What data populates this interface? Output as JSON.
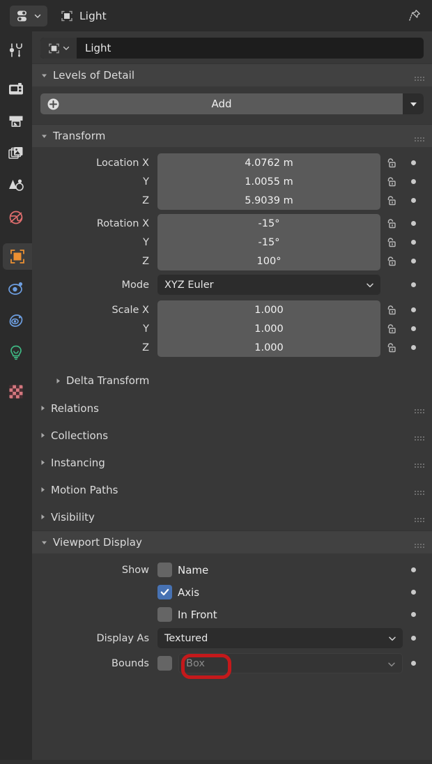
{
  "window": {
    "editor_type_icon": "properties-editor-icon",
    "breadcrumb_icon": "object-icon",
    "breadcrumb_label": "Light",
    "pin_icon": "pin-icon"
  },
  "tabs": [
    {
      "name": "tool",
      "icon": "tool-icon",
      "color": "#d8d8d8",
      "active": false
    },
    {
      "name": "render",
      "icon": "camera-back-icon",
      "color": "#d8d8d8",
      "active": false
    },
    {
      "name": "output",
      "icon": "printer-icon",
      "color": "#d8d8d8",
      "active": false
    },
    {
      "name": "view-layer",
      "icon": "images-icon",
      "color": "#d8d8d8",
      "active": false
    },
    {
      "name": "scene",
      "icon": "cone-sphere-icon",
      "color": "#d8d8d8",
      "active": false
    },
    {
      "name": "world",
      "icon": "world-icon",
      "color": "#e06e6e",
      "active": false
    },
    {
      "name": "object",
      "icon": "object-square-icon",
      "color": "#ec9032",
      "active": true
    },
    {
      "name": "modifiers",
      "icon": "physics-icon",
      "color": "#6d9ee0",
      "active": false
    },
    {
      "name": "constraints",
      "icon": "constraint-icon",
      "color": "#6d9ee0",
      "active": false
    },
    {
      "name": "data",
      "icon": "light-bulb-icon",
      "color": "#3fb984",
      "active": false
    },
    {
      "name": "texture",
      "icon": "checker-icon",
      "color": "#d4777e",
      "active": false
    }
  ],
  "id_block": {
    "icon": "object-icon",
    "dropdown_icon": "chevron-down-icon",
    "name": "Light"
  },
  "panels": {
    "levels_of_detail": {
      "title": "Levels of Detail",
      "expanded": true,
      "triangle": "triangle-down-icon",
      "grip": "grip-icon",
      "add_button": {
        "label": "Add",
        "icon": "plus-circle-icon",
        "menu_icon": "triangle-down-icon"
      }
    },
    "transform": {
      "title": "Transform",
      "expanded": true,
      "triangle": "triangle-down-icon",
      "grip": "grip-icon",
      "location": {
        "label": "Location X",
        "rows": [
          {
            "label": "Location X",
            "value": "4.0762 m",
            "lock": "unlocked-icon",
            "animate": "animate-dot"
          },
          {
            "label": "Y",
            "value": "1.0055 m",
            "lock": "unlocked-icon",
            "animate": "animate-dot"
          },
          {
            "label": "Z",
            "value": "5.9039 m",
            "lock": "unlocked-icon",
            "animate": "animate-dot"
          }
        ]
      },
      "rotation": {
        "rows": [
          {
            "label": "Rotation X",
            "value": "-15°",
            "lock": "unlocked-icon",
            "animate": "animate-dot"
          },
          {
            "label": "Y",
            "value": "-15°",
            "lock": "unlocked-icon",
            "animate": "animate-dot"
          },
          {
            "label": "Z",
            "value": "100°",
            "lock": "unlocked-icon",
            "animate": "animate-dot"
          }
        ]
      },
      "mode": {
        "label": "Mode",
        "value": "XYZ Euler",
        "chevron": "chevron-down-icon"
      },
      "scale": {
        "rows": [
          {
            "label": "Scale X",
            "value": "1.000",
            "lock": "unlocked-icon",
            "animate": "animate-dot"
          },
          {
            "label": "Y",
            "value": "1.000",
            "lock": "unlocked-icon",
            "animate": "animate-dot"
          },
          {
            "label": "Z",
            "value": "1.000",
            "lock": "unlocked-icon",
            "animate": "animate-dot"
          }
        ]
      },
      "delta_transform": {
        "title": "Delta Transform",
        "triangle": "triangle-right-icon"
      }
    },
    "collapsed": [
      {
        "title": "Relations",
        "triangle": "triangle-right-icon",
        "grip": "grip-icon"
      },
      {
        "title": "Collections",
        "triangle": "triangle-right-icon",
        "grip": "grip-icon"
      },
      {
        "title": "Instancing",
        "triangle": "triangle-right-icon",
        "grip": "grip-icon"
      },
      {
        "title": "Motion Paths",
        "triangle": "triangle-right-icon",
        "grip": "grip-icon"
      },
      {
        "title": "Visibility",
        "triangle": "triangle-right-icon",
        "grip": "grip-icon"
      }
    ],
    "viewport_display": {
      "title": "Viewport Display",
      "expanded": true,
      "triangle": "triangle-down-icon",
      "grip": "grip-icon",
      "show_label": "Show",
      "checkboxes": [
        {
          "label": "Name",
          "checked": false,
          "animate": "animate-dot"
        },
        {
          "label": "Axis",
          "checked": true,
          "animate": "animate-dot",
          "highlighted": true
        },
        {
          "label": "In Front",
          "checked": false,
          "animate": "animate-dot"
        }
      ],
      "display_as": {
        "label": "Display As",
        "value": "Textured",
        "chevron": "chevron-down-icon"
      },
      "bounds": {
        "label": "Bounds",
        "checked": false,
        "value": "Box",
        "chevron": "chevron-down-icon",
        "disabled": true
      }
    }
  },
  "colors": {
    "panel_bg": "#383838",
    "header_bg": "#414141",
    "field_bg": "#5a5a5a",
    "dropdown_bg": "#2c2c2c",
    "accent_orange": "#ec9032",
    "checkbox_blue": "#4772b3",
    "highlight_red": "#c4191b",
    "text": "#dcdcdc"
  }
}
